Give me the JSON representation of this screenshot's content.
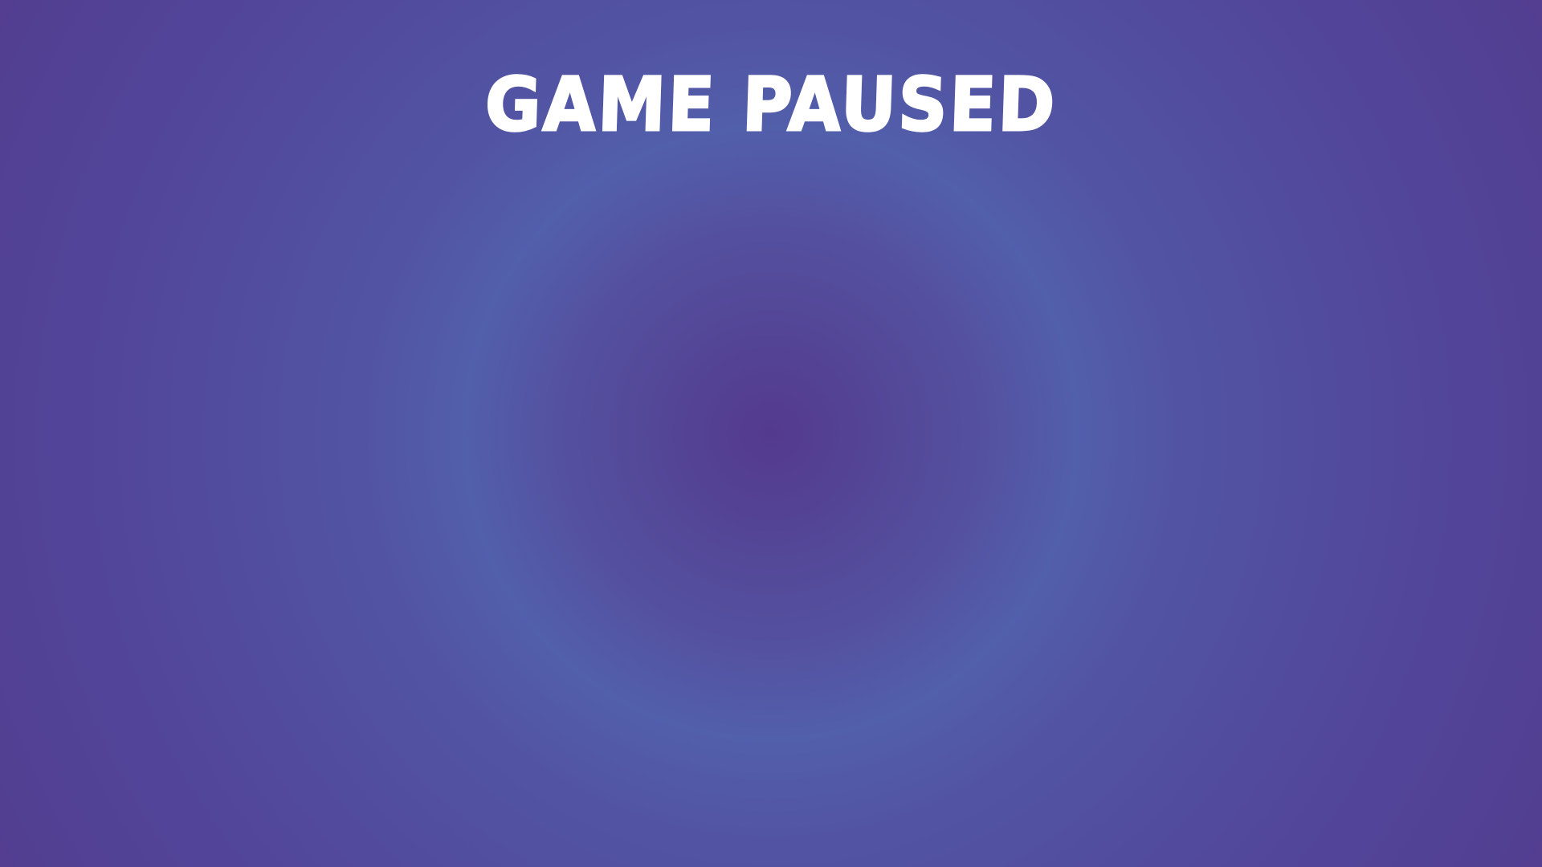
{
  "pause_screen": {
    "title": "GAME PAUSED"
  },
  "colors": {
    "background_center": "#543a8e",
    "background_ring": "#525fab",
    "background_edge": "#53398b",
    "title_text": "#ffffff"
  }
}
